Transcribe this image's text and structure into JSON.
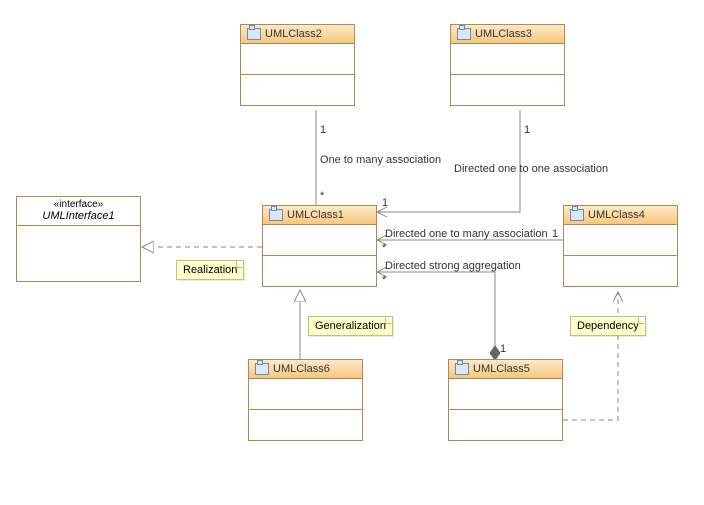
{
  "classes": {
    "interface": {
      "stereotype": "«interface»",
      "name": "UMLInterface1"
    },
    "c1": {
      "name": "UMLClass1"
    },
    "c2": {
      "name": "UMLClass2"
    },
    "c3": {
      "name": "UMLClass3"
    },
    "c4": {
      "name": "UMLClass4"
    },
    "c5": {
      "name": "UMLClass5"
    },
    "c6": {
      "name": "UMLClass6"
    }
  },
  "notes": {
    "realization": "Realization",
    "generalization": "Generalization",
    "dependency": "Dependency"
  },
  "edges": {
    "e1": {
      "label": "One to many association",
      "source_mult": "1",
      "target_mult": "*"
    },
    "e2": {
      "label": "Directed one to one association",
      "source_mult": "1",
      "target_mult": "1"
    },
    "e3": {
      "label": "Directed one to many association",
      "source_mult": "1",
      "target_mult": "*"
    },
    "e4": {
      "label": "Directed strong aggregation",
      "source_mult": "1",
      "target_mult": "*"
    }
  },
  "chart_data": {
    "type": "uml-class-diagram",
    "classes": [
      {
        "id": "UMLInterface1",
        "stereotype": "interface"
      },
      {
        "id": "UMLClass1"
      },
      {
        "id": "UMLClass2"
      },
      {
        "id": "UMLClass3"
      },
      {
        "id": "UMLClass4"
      },
      {
        "id": "UMLClass5"
      },
      {
        "id": "UMLClass6"
      }
    ],
    "relationships": [
      {
        "from": "UMLClass2",
        "to": "UMLClass1",
        "type": "association",
        "label": "One to many association",
        "from_mult": "1",
        "to_mult": "*"
      },
      {
        "from": "UMLClass3",
        "to": "UMLClass1",
        "type": "directed-association",
        "label": "Directed one to one association",
        "from_mult": "1",
        "to_mult": "1"
      },
      {
        "from": "UMLClass4",
        "to": "UMLClass1",
        "type": "directed-association",
        "label": "Directed one to many association",
        "from_mult": "1",
        "to_mult": "*"
      },
      {
        "from": "UMLClass5",
        "to": "UMLClass1",
        "type": "composition",
        "label": "Directed strong aggregation",
        "from_mult": "1",
        "to_mult": "*"
      },
      {
        "from": "UMLClass6",
        "to": "UMLClass1",
        "type": "generalization"
      },
      {
        "from": "UMLClass1",
        "to": "UMLInterface1",
        "type": "realization"
      },
      {
        "from": "UMLClass5",
        "to": "UMLClass4",
        "type": "dependency"
      }
    ]
  }
}
